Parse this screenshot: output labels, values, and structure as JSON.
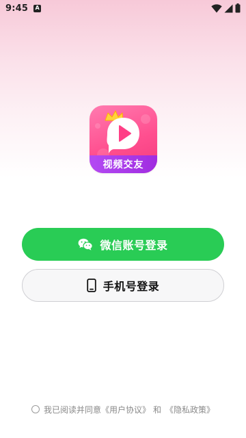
{
  "status_bar": {
    "time": "9:45",
    "notification_icon": "A"
  },
  "app": {
    "logo_label": "视频交友"
  },
  "buttons": {
    "wechat_login": "微信账号登录",
    "phone_login": "手机号登录"
  },
  "agreement": {
    "prefix": "我已阅读并同意",
    "user_agreement": "《用户协议》",
    "and": "和",
    "privacy_policy": "《隐私政策》"
  },
  "colors": {
    "wechat_green": "#29cc55",
    "logo_pink": "#ff4f8f",
    "logo_band_purple": "#a02ce0"
  }
}
